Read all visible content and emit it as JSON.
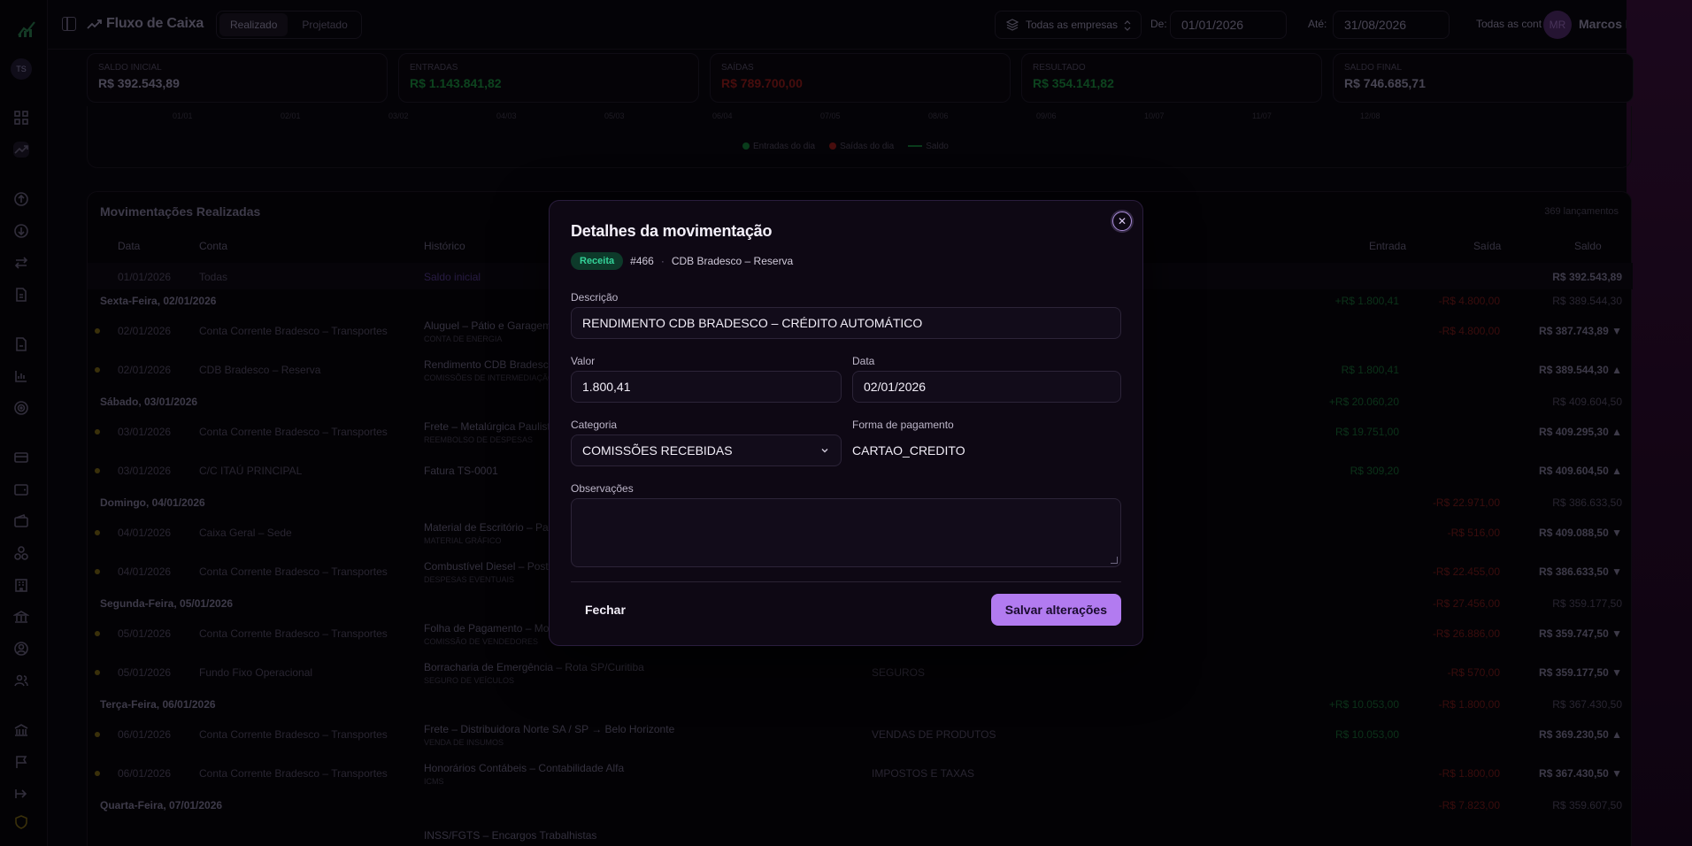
{
  "header": {
    "title": "Fluxo de Caixa",
    "tabs": [
      "Realizado",
      "Projetado"
    ],
    "company_filter": "Todas as empresas",
    "from_label": "De:",
    "from_date": "01/01/2026",
    "to_label": "Até:",
    "to_date": "31/08/2026",
    "accounts_filter": "Todas as cont",
    "user_initials": "MR",
    "user_name": "Marcos Rieper"
  },
  "sidebar": {
    "workspace_initials": "TS"
  },
  "summary": [
    {
      "label": "Saldo inicial",
      "value": "R$ 392.543,89",
      "color": "#6f6a80"
    },
    {
      "label": "Entradas",
      "value": "R$ 1.143.841,82",
      "color": "#14682f"
    },
    {
      "label": "Saídas",
      "value": "R$ 789.700,00",
      "color": "#6e1414"
    },
    {
      "label": "Resultado",
      "value": "R$ 354.141,82",
      "color": "#14682f"
    },
    {
      "label": "Saldo final",
      "value": "R$ 746.685,71",
      "color": "#6f6a80"
    }
  ],
  "chart": {
    "ticks": [
      "01/01",
      "02/01",
      "03/02",
      "04/03",
      "05/03",
      "06/04",
      "07/05",
      "08/06",
      "09/06",
      "10/07",
      "11/07",
      "12/08"
    ],
    "legend": [
      {
        "label": "Entradas do dia",
        "color": "#0f5c2a"
      },
      {
        "label": "Saídas do dia",
        "color": "#6e1414"
      },
      {
        "label": "Saldo",
        "color": "#0f5c2a"
      }
    ]
  },
  "table": {
    "title": "Movimentações Realizadas",
    "count": "369 lançamentos",
    "headers": {
      "date": "Data",
      "account": "Conta",
      "history": "Histórico",
      "in": "Entrada",
      "out": "Saída",
      "balance": "Saldo"
    },
    "opening": {
      "date": "01/01/2026",
      "account": "Todas",
      "history": "Saldo inicial",
      "balance": "R$ 392.543,89"
    },
    "rows": [
      {
        "kind": "group",
        "label": "Sexta-Feira, 02/01/2026",
        "in": "+R$ 1.800,41",
        "out": "-R$ 4.800,00",
        "balance": "R$ 389.544,30"
      },
      {
        "kind": "item",
        "date": "02/01/2026",
        "account": "Conta Corrente Bradesco – Transportes",
        "history": "Aluguel – Pátio e Garagem",
        "sub": "CONTA DE ENERGIA",
        "in": "",
        "out": "-R$ 4.800,00",
        "balance": "R$ 387.743,89 ▼"
      },
      {
        "kind": "item",
        "date": "02/01/2026",
        "account": "CDB Bradesco – Reserva",
        "history": "Rendimento CDB Bradesco",
        "sub": "COMISSÕES DE INTERMEDIAÇÃO",
        "in": "R$ 1.800,41",
        "out": "",
        "balance": "R$ 389.544,30 ▲"
      },
      {
        "kind": "group",
        "label": "Sábado, 03/01/2026",
        "in": "+R$ 20.060,20",
        "out": "",
        "balance": "R$ 409.604,50"
      },
      {
        "kind": "item",
        "date": "03/01/2026",
        "account": "Conta Corrente Bradesco – Transportes",
        "history": "Frete – Metalúrgica Paulista",
        "sub": "REEMBOLSO DE DESPESAS",
        "in": "R$ 19.751,00",
        "out": "",
        "balance": "R$ 409.295,30 ▲"
      },
      {
        "kind": "item",
        "date": "03/01/2026",
        "account": "C/C ITAÚ PRINCIPAL",
        "history": "Fatura TS-0001",
        "sub": "",
        "in": "R$ 309,20",
        "out": "",
        "balance": "R$ 409.604,50 ▲"
      },
      {
        "kind": "group",
        "label": "Domingo, 04/01/2026",
        "in": "",
        "out": "-R$ 22.971,00",
        "balance": "R$ 386.633,50"
      },
      {
        "kind": "item",
        "date": "04/01/2026",
        "account": "Caixa Geral – Sede",
        "history": "Material de Escritório – Papelaria",
        "sub": "MATERIAL GRÁFICO",
        "in": "",
        "out": "-R$ 516,00",
        "balance": "R$ 409.088,50 ▼"
      },
      {
        "kind": "item",
        "date": "04/01/2026",
        "account": "Conta Corrente Bradesco – Transportes",
        "history": "Combustível Diesel – Posto",
        "sub": "DESPESAS EVENTUAIS",
        "in": "",
        "out": "-R$ 22.455,00",
        "balance": "R$ 386.633,50 ▼"
      },
      {
        "kind": "group",
        "label": "Segunda-Feira, 05/01/2026",
        "in": "",
        "out": "-R$ 27.456,00",
        "balance": "R$ 359.177,50"
      },
      {
        "kind": "item",
        "date": "05/01/2026",
        "account": "Conta Corrente Bradesco – Transportes",
        "history": "Folha de Pagamento – Motoristas",
        "sub": "COMISSÃO DE VENDEDORES",
        "in": "",
        "out": "-R$ 26.886,00",
        "balance": "R$ 359.747,50 ▼"
      },
      {
        "kind": "item",
        "date": "05/01/2026",
        "account": "Fundo Fixo Operacional",
        "history": "Borracharia de Emergência – Rota SP/Curitiba",
        "sub": "SEGURO DE VEÍCULOS",
        "category": "SEGUROS",
        "in": "",
        "out": "-R$ 570,00",
        "balance": "R$ 359.177,50 ▼"
      },
      {
        "kind": "group",
        "label": "Terça-Feira, 06/01/2026",
        "in": "+R$ 10.053,00",
        "out": "-R$ 1.800,00",
        "balance": "R$ 367.430,50"
      },
      {
        "kind": "item",
        "date": "06/01/2026",
        "account": "Conta Corrente Bradesco – Transportes",
        "history": "Frete – Distribuidora Norte SA / SP → Belo Horizonte",
        "sub": "VENDA DE INSUMOS",
        "category": "VENDAS DE PRODUTOS",
        "in": "R$ 10.053,00",
        "out": "",
        "balance": "R$ 369.230,50 ▲"
      },
      {
        "kind": "item",
        "date": "06/01/2026",
        "account": "Conta Corrente Bradesco – Transportes",
        "history": "Honorários Contábeis – Contabilidade Alfa",
        "sub": "ICMS",
        "category": "IMPOSTOS E TAXAS",
        "in": "",
        "out": "-R$ 1.800,00",
        "balance": "R$ 367.430,50 ▼"
      },
      {
        "kind": "group",
        "label": "Quarta-Feira, 07/01/2026",
        "in": "",
        "out": "-R$ 7.823,00",
        "balance": "R$ 359.607,50"
      },
      {
        "kind": "item",
        "date": "",
        "account": "",
        "history": "INSS/FGTS – Encargos Trabalhistas",
        "sub": "",
        "in": "",
        "out": "",
        "balance": ""
      }
    ]
  },
  "modal": {
    "title": "Detalhes da movimentação",
    "close_glyph": "✕",
    "badge": "Receita",
    "number": "#466",
    "separator": "·",
    "account": "CDB Bradesco – Reserva",
    "description_label": "Descrição",
    "description": "RENDIMENTO CDB BRADESCO – CRÉDITO AUTOMÁTICO",
    "value_label": "Valor",
    "value": "1.800,41",
    "date_label": "Data",
    "date": "02/01/2026",
    "category_label": "Categoria",
    "category": "COMISSÕES RECEBIDAS",
    "payment_label": "Forma de pagamento",
    "payment": "CARTAO_CREDITO",
    "notes_label": "Observações",
    "notes": "",
    "close_button": "Fechar",
    "save_button": "Salvar alterações",
    "accent_color": "#b27bf0"
  }
}
